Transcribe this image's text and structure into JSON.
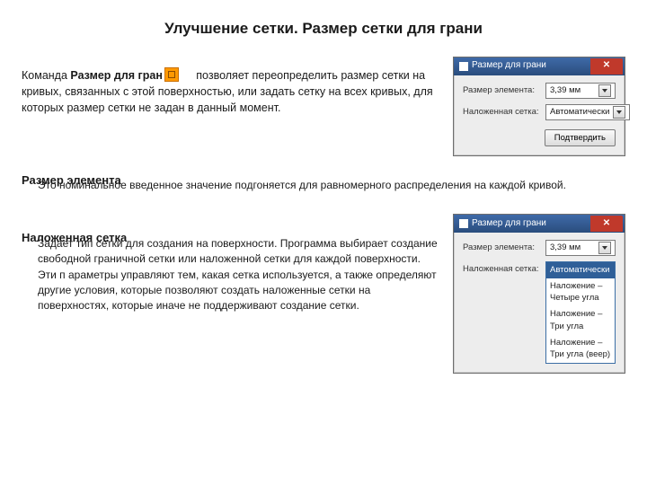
{
  "title": "Улучшение сетки. Размер сетки для грани",
  "intro": {
    "pre": "Команда ",
    "cmd": "Размер для гран",
    "post": " позволяет переопределить размер сетки на кривых, связанных с этой поверхностью, или задать сетку на всех кривых, для которых размер сетки не задан в данный момент."
  },
  "section1": {
    "heading": "Размер элемента",
    "text": "Это номинальное введенное значение подгоняется для равномерного распределения на каждой кривой."
  },
  "section2": {
    "heading": "Наложенная сетка",
    "text": "Задает тип сетки для создания на поверхности. Программа выбирает создание свободной граничной сетки или наложенной сетки для каждой поверхности. Эти п араметры  управляют тем, какая сетка используется, а также определяют другие условия, которые позволяют создать наложенные сетки на поверхностях, которые иначе не поддерживают создание сетки."
  },
  "dialog": {
    "title": "Размер для грани",
    "field_size_label": "Размер элемента:",
    "field_size_value": "3,39 мм",
    "field_mesh_label": "Наложенная сетка:",
    "field_mesh_value": "Автоматически",
    "confirm": "Подтвердить",
    "options": {
      "selected": "Автоматически",
      "o1": "Наложение – Четыре угла",
      "o2": "Наложение – Три угла",
      "o3": "Наложение – Три угла (веер)"
    }
  }
}
